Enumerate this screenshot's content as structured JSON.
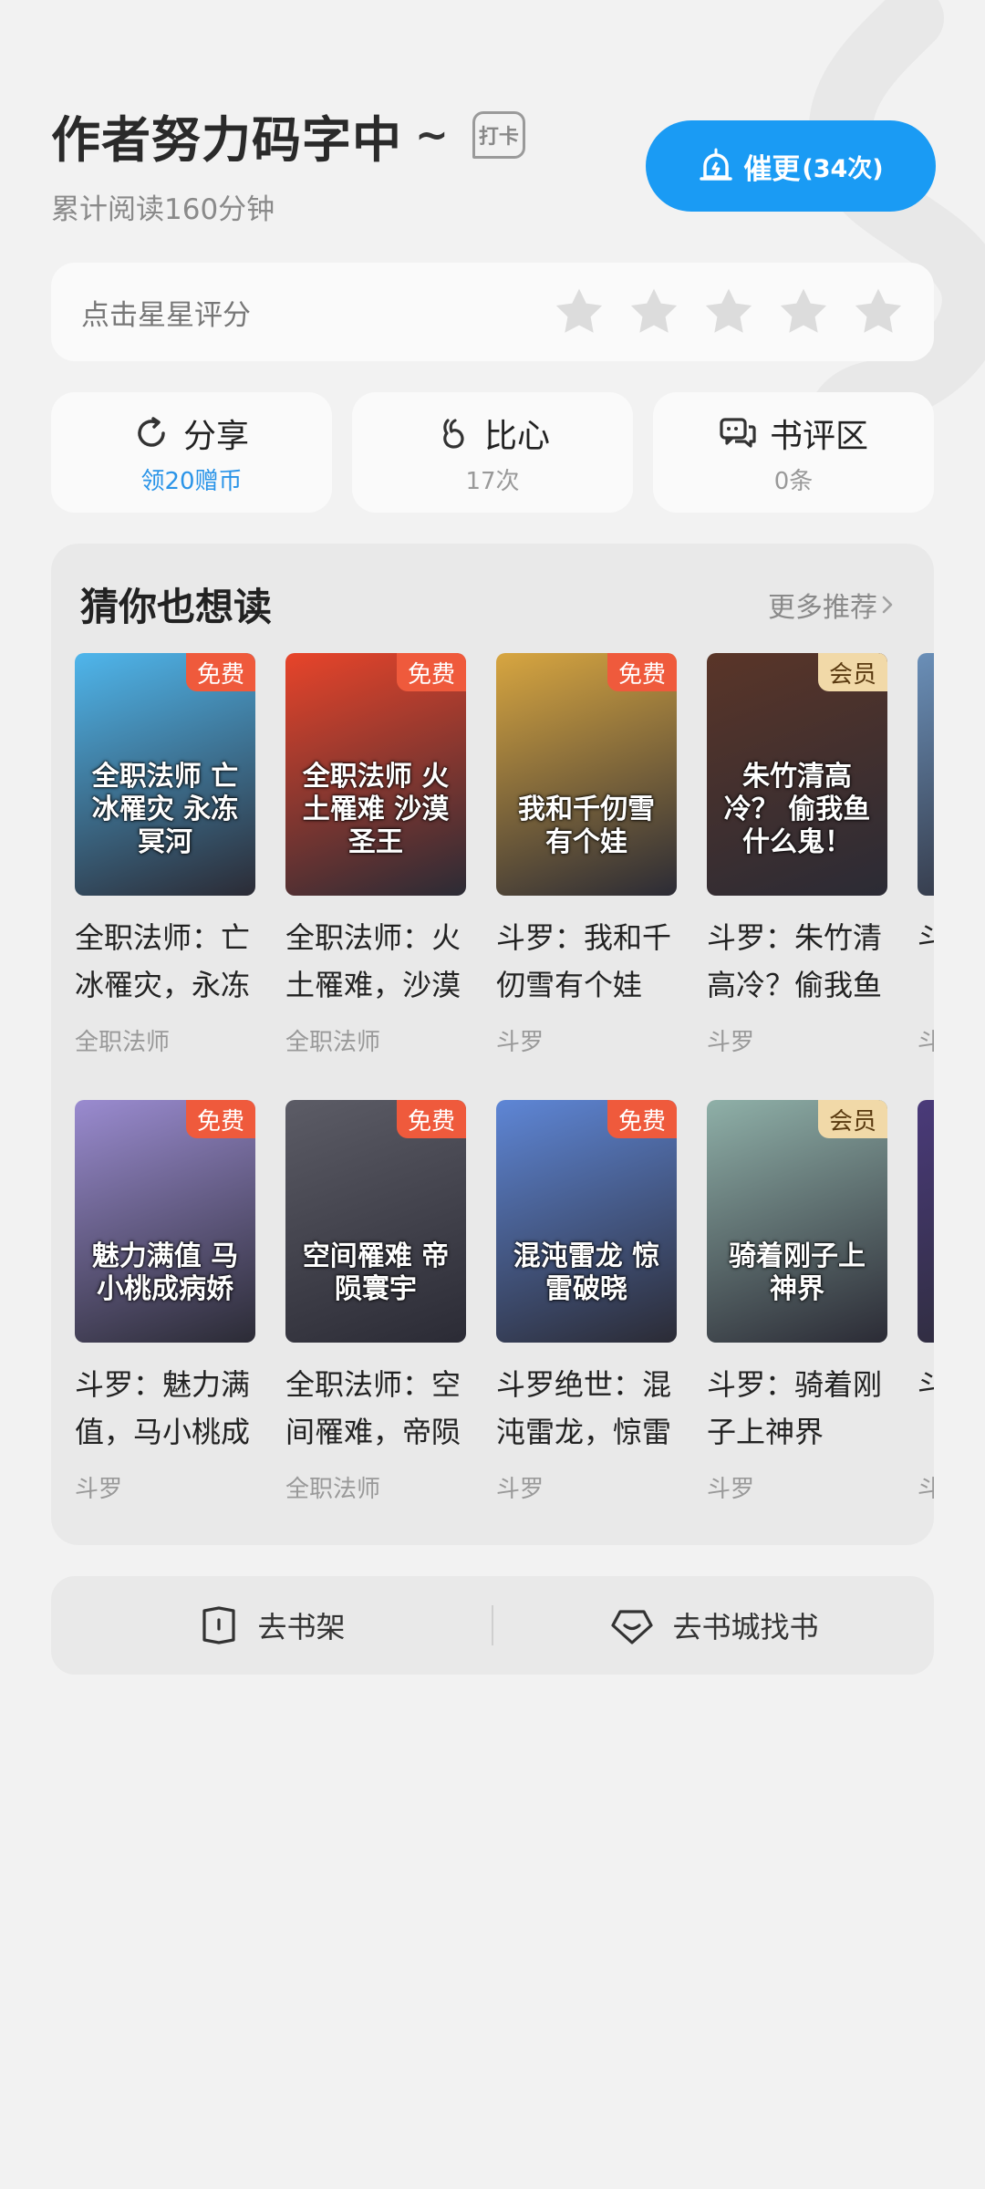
{
  "header": {
    "title": "作者努力码字中",
    "tilde": "~",
    "checkin_label": "打卡",
    "reading_time": "累计阅读160分钟",
    "urge_button": {
      "label": "催更",
      "count": "(34次)"
    }
  },
  "rating": {
    "label": "点击星星评分",
    "stars": 5
  },
  "actions": [
    {
      "icon": "share-icon",
      "label": "分享",
      "sub": "领20赠币"
    },
    {
      "icon": "finger-heart-icon",
      "label": "比心",
      "sub": "17次"
    },
    {
      "icon": "comment-icon",
      "label": "书评区",
      "sub": "0条"
    }
  ],
  "recommendations": {
    "title": "猜你也想读",
    "more": "更多推荐",
    "rows": [
      [
        {
          "title": "全职法师：亡冰罹灾，永冻",
          "tag": "全职法师",
          "badge": "免费",
          "cover_text": "全职法师 亡冰罹灾 永冻冥河",
          "color": "#4fb6ec"
        },
        {
          "title": "全职法师：火土罹难，沙漠",
          "tag": "全职法师",
          "badge": "免费",
          "cover_text": "全职法师 火土罹难 沙漠圣王",
          "color": "#e8442a"
        },
        {
          "title": "斗罗：我和千仞雪有个娃",
          "tag": "斗罗",
          "badge": "免费",
          "cover_text": "我和千仞雪 有个娃",
          "color": "#d8a640"
        },
        {
          "title": "斗罗：朱竹清高冷？偷我鱼",
          "tag": "斗罗",
          "badge": "会员",
          "cover_text": "朱竹清高冷？ 偷我鱼什么鬼！",
          "color": "#5a3528"
        },
        {
          "title": "斗罗：蛋",
          "tag": "斗",
          "badge": "",
          "cover_text": "",
          "color": "#6a8fb8"
        }
      ],
      [
        {
          "title": "斗罗：魅力满值，马小桃成",
          "tag": "斗罗",
          "badge": "免费",
          "cover_text": "魅力满值 马小桃成病娇",
          "color": "#9a8bd0"
        },
        {
          "title": "全职法师：空间罹难，帝陨",
          "tag": "全职法师",
          "badge": "免费",
          "cover_text": "空间罹难 帝陨寰宇",
          "color": "#5c5c66"
        },
        {
          "title": "斗罗绝世：混沌雷龙，惊雷",
          "tag": "斗罗",
          "badge": "免费",
          "cover_text": "混沌雷龙 惊雷破晓",
          "color": "#5e86d6"
        },
        {
          "title": "斗罗：骑着刚子上神界",
          "tag": "斗罗",
          "badge": "会员",
          "cover_text": "骑着刚子上神界",
          "color": "#8fb0a8"
        },
        {
          "title": "斗罗：谷",
          "tag": "斗",
          "badge": "",
          "cover_text": "",
          "color": "#4a3a7a"
        }
      ]
    ]
  },
  "bottom_bar": {
    "bookshelf": "去书架",
    "bookstore": "去书城找书"
  },
  "colors": {
    "accent": "#1a9bf4",
    "free_badge": "#ef5a3c",
    "vip_badge": "#f1d9a8",
    "share_sub": "#2a94e8"
  }
}
